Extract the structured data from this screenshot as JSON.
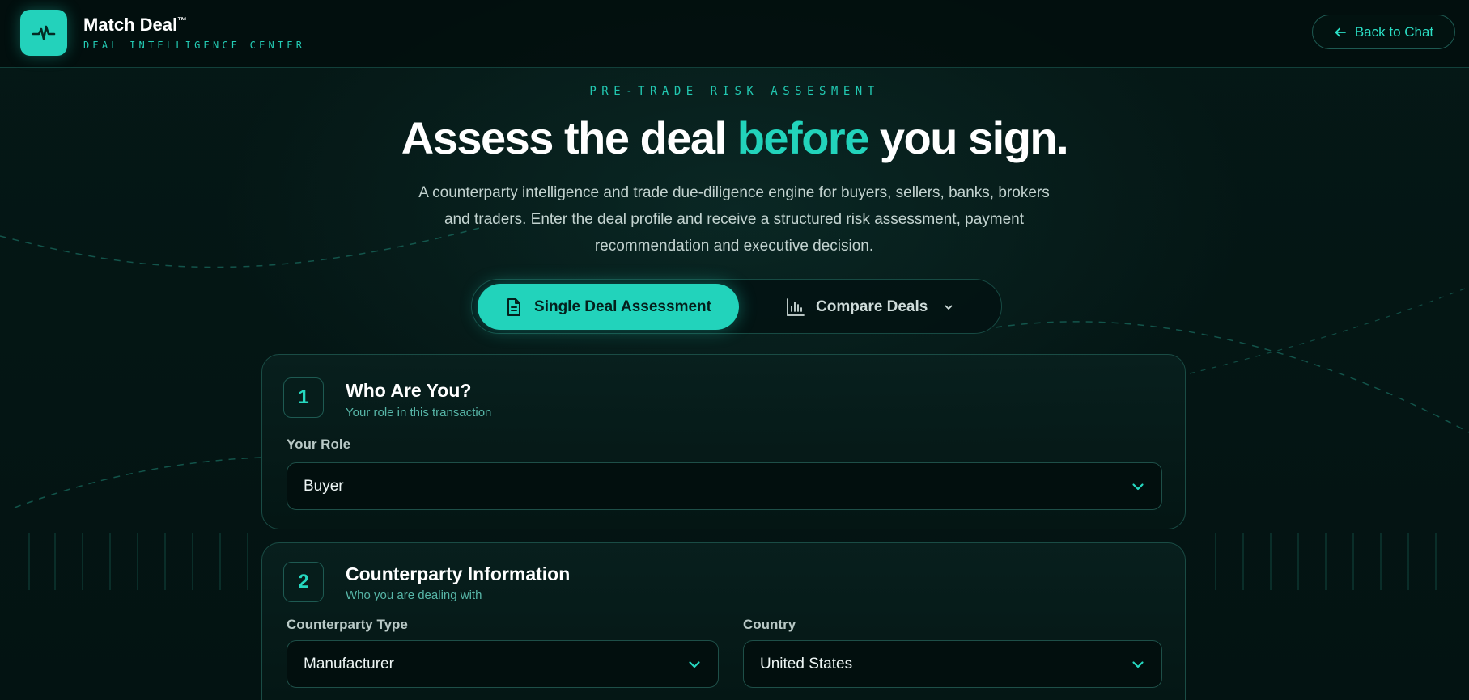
{
  "header": {
    "brand_name": "Match Deal",
    "brand_mark": "™",
    "brand_subtitle": "DEAL INTELLIGENCE CENTER",
    "back_label": "Back to Chat",
    "logo_icon": "pulse-icon",
    "back_icon": "arrow-left-icon"
  },
  "hero": {
    "eyebrow": "PRE-TRADE RISK ASSESMENT",
    "title_part1": "Assess the deal ",
    "title_accent": "before",
    "title_part2": " you sign.",
    "description": "A counterparty intelligence and trade due-diligence engine for buyers, sellers, banks, brokers and traders. Enter the deal profile and receive a structured risk assessment, payment recommendation and executive decision."
  },
  "mode_tabs": [
    {
      "label": "Single Deal Assessment",
      "icon": "document-icon",
      "active": true
    },
    {
      "label": "Compare Deals",
      "icon": "bar-chart-icon",
      "active": false
    }
  ],
  "sections": [
    {
      "number": "1",
      "title": "Who Are You?",
      "subtitle": "Your role in this transaction",
      "fields": [
        {
          "label": "Your Role",
          "value": "Buyer"
        }
      ]
    },
    {
      "number": "2",
      "title": "Counterparty Information",
      "subtitle": "Who you are dealing with",
      "fields": [
        {
          "label": "Counterparty Type",
          "value": "Manufacturer"
        },
        {
          "label": "Country",
          "value": "United States"
        }
      ]
    }
  ],
  "colors": {
    "accent": "#22d3bb",
    "background": "#031312",
    "card_border": "#1a4c45"
  }
}
